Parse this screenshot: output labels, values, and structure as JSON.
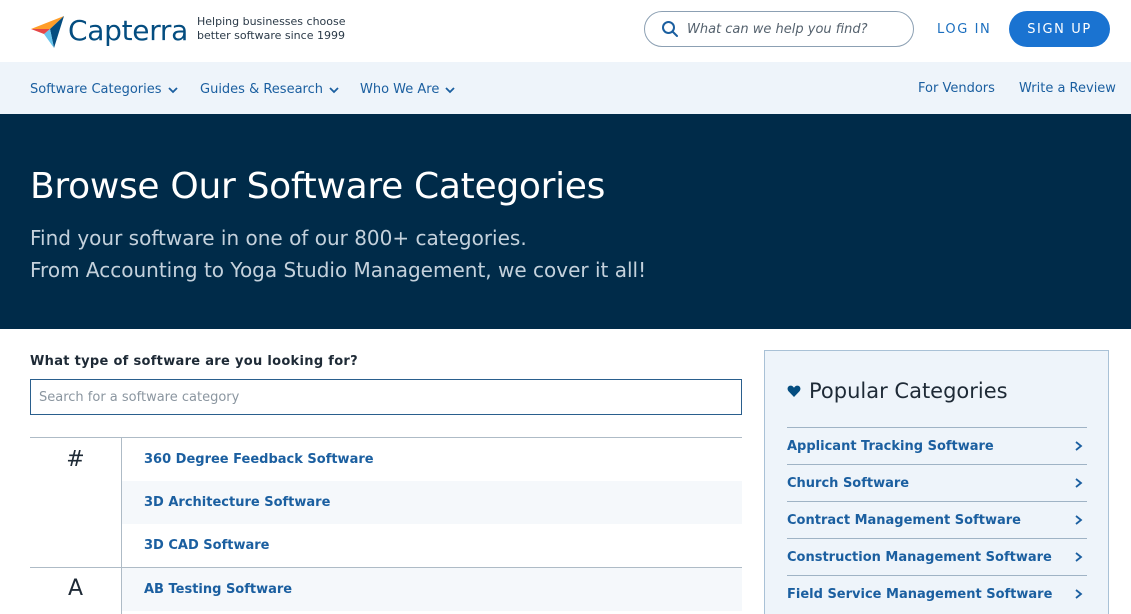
{
  "header": {
    "brand": "Capterra",
    "tagline_line1": "Helping businesses choose",
    "tagline_line2": "better software since 1999",
    "search_placeholder": "What can we help you find?",
    "login_label": "LOG IN",
    "signup_label": "SIGN UP"
  },
  "nav": {
    "items": [
      {
        "label": "Software Categories"
      },
      {
        "label": "Guides & Research"
      },
      {
        "label": "Who We Are"
      }
    ],
    "vendors_label": "For Vendors",
    "review_label": "Write a Review"
  },
  "hero": {
    "title": "Browse Our Software Categories",
    "line1": "Find your software in one of our 800+ categories.",
    "line2": "From Accounting to Yoga Studio Management, we cover it all!"
  },
  "main": {
    "question": "What type of software are you looking for?",
    "search_placeholder": "Search for a software category",
    "sections": [
      {
        "letter": "#",
        "items": [
          "360 Degree Feedback Software",
          "3D Architecture Software",
          "3D CAD Software"
        ]
      },
      {
        "letter": "A",
        "items": [
          "AB Testing Software"
        ]
      }
    ]
  },
  "popular": {
    "title": "Popular Categories",
    "items": [
      "Applicant Tracking Software",
      "Church Software",
      "Contract Management Software",
      "Construction Management Software",
      "Field Service Management Software"
    ]
  },
  "colors": {
    "brand_blue": "#044d80",
    "accent_blue": "#1a73d1",
    "hero_bg": "#002b49",
    "nav_bg": "#eef4fa",
    "link_blue": "#1b5fa0"
  }
}
